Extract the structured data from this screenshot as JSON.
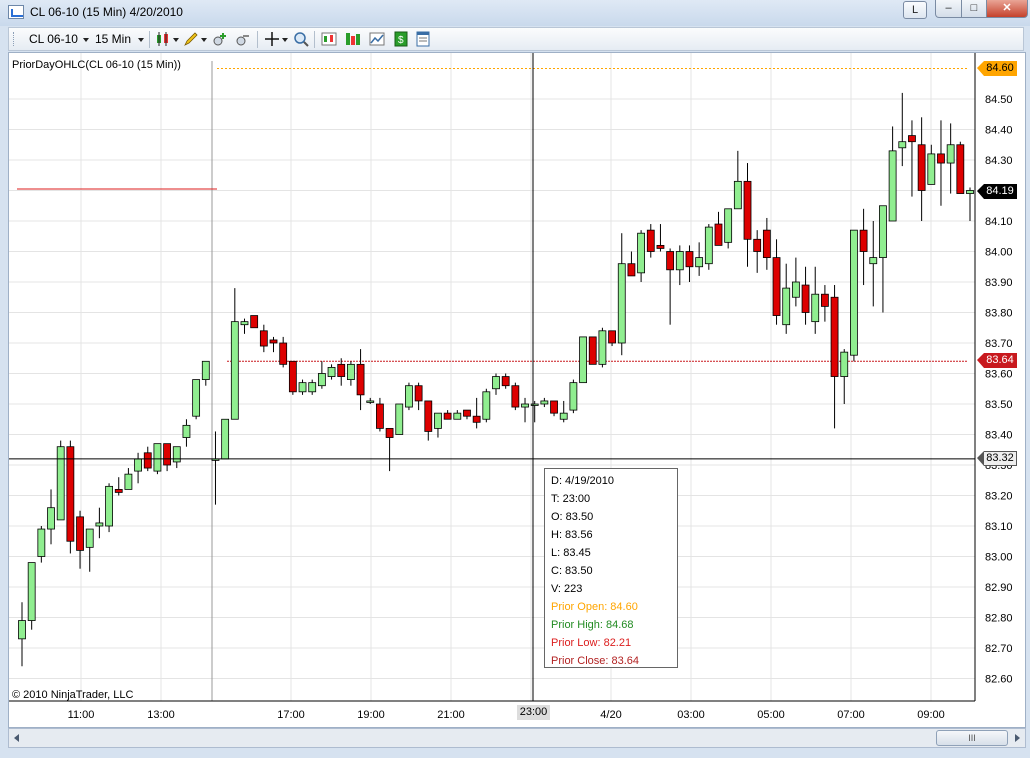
{
  "window": {
    "title": "CL 06-10 (15 Min)  4/20/2010",
    "btn_l": "L",
    "btn_min": "–",
    "btn_max": "□",
    "btn_close": "✕"
  },
  "toolbar": {
    "instrument": "CL 06-10",
    "interval": "15 Min",
    "icons": [
      "candlestick-style-icon",
      "pencil-draw-icon",
      "zoom-in-icon",
      "zoom-out-icon",
      "crosshair-icon",
      "magnifier-icon",
      "data-series-icon",
      "indicators-icon",
      "strategies-icon",
      "order-icon",
      "properties-icon"
    ]
  },
  "chart": {
    "indicator_label": "PriorDayOHLC(CL 06-10 (15 Min))",
    "copyright": "© 2010 NinjaTrader, LLC",
    "price_axis_labels": [
      "84.50",
      "84.40",
      "84.30",
      "84.20",
      "84.10",
      "84.00",
      "83.90",
      "83.80",
      "83.70",
      "83.60",
      "83.50",
      "83.40",
      "83.30",
      "83.20",
      "83.10",
      "83.00",
      "82.90",
      "82.80",
      "82.70",
      "82.60"
    ],
    "time_axis_labels": [
      "11:00",
      "13:00",
      "17:00",
      "19:00",
      "21:00",
      "23:00",
      "4/20",
      "03:00",
      "05:00",
      "07:00",
      "09:00"
    ],
    "price_tags": {
      "prior_open": "84.60",
      "last": "84.19",
      "prior_close": "83.64",
      "cursor": "83.32"
    },
    "colors": {
      "up": "#90ee90",
      "down": "#dd0000",
      "prior_open": "#ffa500",
      "prior_close": "#c8191e",
      "prior_low": "#dc1e1e"
    }
  },
  "chart_data": {
    "type": "candlestick",
    "title": "CL 06-10 (15 Min)",
    "y_range": [
      82.55,
      84.6
    ],
    "candles": [
      {
        "o": 82.73,
        "h": 82.85,
        "l": 82.64,
        "c": 82.79
      },
      {
        "o": 82.79,
        "h": 82.98,
        "l": 82.76,
        "c": 82.98
      },
      {
        "o": 83.0,
        "h": 83.1,
        "l": 82.98,
        "c": 83.09
      },
      {
        "o": 83.09,
        "h": 83.22,
        "l": 83.04,
        "c": 83.16
      },
      {
        "o": 83.12,
        "h": 83.38,
        "l": 83.12,
        "c": 83.36
      },
      {
        "o": 83.36,
        "h": 83.38,
        "l": 83.01,
        "c": 83.05
      },
      {
        "o": 83.13,
        "h": 83.15,
        "l": 82.96,
        "c": 83.02
      },
      {
        "o": 83.03,
        "h": 83.06,
        "l": 82.95,
        "c": 83.09
      },
      {
        "o": 83.1,
        "h": 83.16,
        "l": 83.06,
        "c": 83.11
      },
      {
        "o": 83.1,
        "h": 83.24,
        "l": 83.08,
        "c": 83.23
      },
      {
        "o": 83.22,
        "h": 83.26,
        "l": 83.2,
        "c": 83.21
      },
      {
        "o": 83.22,
        "h": 83.29,
        "l": 83.22,
        "c": 83.27
      },
      {
        "o": 83.28,
        "h": 83.34,
        "l": 83.24,
        "c": 83.32
      },
      {
        "o": 83.34,
        "h": 83.36,
        "l": 83.28,
        "c": 83.29
      },
      {
        "o": 83.28,
        "h": 83.37,
        "l": 83.27,
        "c": 83.37
      },
      {
        "o": 83.37,
        "h": 83.37,
        "l": 83.28,
        "c": 83.3
      },
      {
        "o": 83.31,
        "h": 83.36,
        "l": 83.29,
        "c": 83.36
      },
      {
        "o": 83.39,
        "h": 83.45,
        "l": 83.36,
        "c": 83.43
      },
      {
        "o": 83.46,
        "h": 83.58,
        "l": 83.45,
        "c": 83.58
      },
      {
        "o": 83.58,
        "h": 83.64,
        "l": 83.56,
        "c": 83.64
      },
      {
        "o": 83.32,
        "h": 83.41,
        "l": 83.17,
        "c": 83.32
      },
      {
        "o": 83.32,
        "h": 83.45,
        "l": 83.32,
        "c": 83.45
      },
      {
        "o": 83.45,
        "h": 83.88,
        "l": 83.45,
        "c": 83.77
      },
      {
        "o": 83.76,
        "h": 83.78,
        "l": 83.73,
        "c": 83.77
      },
      {
        "o": 83.79,
        "h": 83.79,
        "l": 83.75,
        "c": 83.75
      },
      {
        "o": 83.74,
        "h": 83.76,
        "l": 83.67,
        "c": 83.69
      },
      {
        "o": 83.71,
        "h": 83.72,
        "l": 83.67,
        "c": 83.7
      },
      {
        "o": 83.7,
        "h": 83.72,
        "l": 83.62,
        "c": 83.63
      },
      {
        "o": 83.64,
        "h": 83.64,
        "l": 83.53,
        "c": 83.54
      },
      {
        "o": 83.54,
        "h": 83.58,
        "l": 83.53,
        "c": 83.57
      },
      {
        "o": 83.54,
        "h": 83.58,
        "l": 83.53,
        "c": 83.57
      },
      {
        "o": 83.56,
        "h": 83.64,
        "l": 83.55,
        "c": 83.6
      },
      {
        "o": 83.59,
        "h": 83.63,
        "l": 83.58,
        "c": 83.62
      },
      {
        "o": 83.63,
        "h": 83.65,
        "l": 83.56,
        "c": 83.59
      },
      {
        "o": 83.58,
        "h": 83.64,
        "l": 83.56,
        "c": 83.63
      },
      {
        "o": 83.63,
        "h": 83.68,
        "l": 83.48,
        "c": 83.53
      },
      {
        "o": 83.51,
        "h": 83.52,
        "l": 83.5,
        "c": 83.51
      },
      {
        "o": 83.5,
        "h": 83.52,
        "l": 83.41,
        "c": 83.42
      },
      {
        "o": 83.42,
        "h": 83.42,
        "l": 83.28,
        "c": 83.39
      },
      {
        "o": 83.4,
        "h": 83.5,
        "l": 83.4,
        "c": 83.5
      },
      {
        "o": 83.49,
        "h": 83.57,
        "l": 83.48,
        "c": 83.56
      },
      {
        "o": 83.56,
        "h": 83.57,
        "l": 83.48,
        "c": 83.51
      },
      {
        "o": 83.51,
        "h": 83.51,
        "l": 83.38,
        "c": 83.41
      },
      {
        "o": 83.42,
        "h": 83.47,
        "l": 83.39,
        "c": 83.47
      },
      {
        "o": 83.47,
        "h": 83.48,
        "l": 83.45,
        "c": 83.45
      },
      {
        "o": 83.45,
        "h": 83.48,
        "l": 83.45,
        "c": 83.47
      },
      {
        "o": 83.48,
        "h": 83.48,
        "l": 83.45,
        "c": 83.46
      },
      {
        "o": 83.46,
        "h": 83.52,
        "l": 83.42,
        "c": 83.44
      },
      {
        "o": 83.45,
        "h": 83.55,
        "l": 83.44,
        "c": 83.54
      },
      {
        "o": 83.55,
        "h": 83.6,
        "l": 83.53,
        "c": 83.59
      },
      {
        "o": 83.59,
        "h": 83.6,
        "l": 83.55,
        "c": 83.56
      },
      {
        "o": 83.56,
        "h": 83.57,
        "l": 83.48,
        "c": 83.49
      },
      {
        "o": 83.49,
        "h": 83.52,
        "l": 83.44,
        "c": 83.5
      },
      {
        "o": 83.5,
        "h": 83.51,
        "l": 83.44,
        "c": 83.5
      },
      {
        "o": 83.5,
        "h": 83.52,
        "l": 83.49,
        "c": 83.51
      },
      {
        "o": 83.51,
        "h": 83.51,
        "l": 83.46,
        "c": 83.47
      },
      {
        "o": 83.45,
        "h": 83.51,
        "l": 83.44,
        "c": 83.47
      },
      {
        "o": 83.48,
        "h": 83.58,
        "l": 83.47,
        "c": 83.57
      },
      {
        "o": 83.57,
        "h": 83.72,
        "l": 83.57,
        "c": 83.72
      },
      {
        "o": 83.72,
        "h": 83.72,
        "l": 83.63,
        "c": 83.63
      },
      {
        "o": 83.63,
        "h": 83.75,
        "l": 83.62,
        "c": 83.74
      },
      {
        "o": 83.74,
        "h": 83.72,
        "l": 83.69,
        "c": 83.7
      },
      {
        "o": 83.7,
        "h": 84.06,
        "l": 83.66,
        "c": 83.96
      },
      {
        "o": 83.96,
        "h": 84.0,
        "l": 83.92,
        "c": 83.92
      },
      {
        "o": 83.93,
        "h": 84.07,
        "l": 83.9,
        "c": 84.06
      },
      {
        "o": 84.07,
        "h": 84.09,
        "l": 83.98,
        "c": 84.0
      },
      {
        "o": 84.02,
        "h": 84.09,
        "l": 84.0,
        "c": 84.01
      },
      {
        "o": 84.0,
        "h": 84.01,
        "l": 83.76,
        "c": 83.94
      },
      {
        "o": 83.94,
        "h": 84.02,
        "l": 83.89,
        "c": 84.0
      },
      {
        "o": 84.0,
        "h": 84.02,
        "l": 83.9,
        "c": 83.95
      },
      {
        "o": 83.95,
        "h": 84.03,
        "l": 83.92,
        "c": 83.98
      },
      {
        "o": 83.96,
        "h": 84.09,
        "l": 83.94,
        "c": 84.08
      },
      {
        "o": 84.09,
        "h": 84.13,
        "l": 84.02,
        "c": 84.02
      },
      {
        "o": 84.03,
        "h": 84.14,
        "l": 84.01,
        "c": 84.14
      },
      {
        "o": 84.14,
        "h": 84.33,
        "l": 84.14,
        "c": 84.23
      },
      {
        "o": 84.23,
        "h": 84.29,
        "l": 83.95,
        "c": 84.04
      },
      {
        "o": 84.04,
        "h": 84.07,
        "l": 83.93,
        "c": 84.0
      },
      {
        "o": 84.07,
        "h": 84.11,
        "l": 83.94,
        "c": 83.98
      },
      {
        "o": 83.98,
        "h": 84.04,
        "l": 83.76,
        "c": 83.79
      },
      {
        "o": 83.76,
        "h": 83.96,
        "l": 83.73,
        "c": 83.88
      },
      {
        "o": 83.85,
        "h": 83.98,
        "l": 83.82,
        "c": 83.9
      },
      {
        "o": 83.89,
        "h": 83.95,
        "l": 83.76,
        "c": 83.8
      },
      {
        "o": 83.77,
        "h": 83.95,
        "l": 83.73,
        "c": 83.86
      },
      {
        "o": 83.86,
        "h": 83.89,
        "l": 83.77,
        "c": 83.82
      },
      {
        "o": 83.85,
        "h": 83.89,
        "l": 83.42,
        "c": 83.59
      },
      {
        "o": 83.59,
        "h": 83.68,
        "l": 83.5,
        "c": 83.67
      },
      {
        "o": 83.66,
        "h": 83.88,
        "l": 83.64,
        "c": 84.07
      },
      {
        "o": 84.07,
        "h": 84.14,
        "l": 83.89,
        "c": 84.0
      },
      {
        "o": 83.96,
        "h": 84.1,
        "l": 83.82,
        "c": 83.98
      },
      {
        "o": 83.98,
        "h": 84.15,
        "l": 83.8,
        "c": 84.15
      },
      {
        "o": 84.1,
        "h": 84.41,
        "l": 84.1,
        "c": 84.33
      },
      {
        "o": 84.34,
        "h": 84.52,
        "l": 84.28,
        "c": 84.36
      },
      {
        "o": 84.38,
        "h": 84.43,
        "l": 84.18,
        "c": 84.36
      },
      {
        "o": 84.35,
        "h": 84.44,
        "l": 84.1,
        "c": 84.2
      },
      {
        "o": 84.22,
        "h": 84.35,
        "l": 84.22,
        "c": 84.32
      },
      {
        "o": 84.32,
        "h": 84.43,
        "l": 84.15,
        "c": 84.29
      },
      {
        "o": 84.29,
        "h": 84.42,
        "l": 84.19,
        "c": 84.35
      },
      {
        "o": 84.35,
        "h": 84.36,
        "l": 84.19,
        "c": 84.19
      },
      {
        "o": 84.19,
        "h": 84.21,
        "l": 84.1,
        "c": 84.2
      }
    ],
    "prior_day_levels": {
      "open": 84.6,
      "high": 84.68,
      "low": 82.21,
      "close": 83.64
    },
    "crosshair": {
      "time": "23:00",
      "price": 83.32
    }
  },
  "data_box": {
    "date": "D: 4/19/2010",
    "time": "T: 23:00",
    "open": "O: 83.50",
    "high": "H: 83.56",
    "low": "L: 83.45",
    "close": "C: 83.50",
    "volume": "V: 223",
    "prior_open": "Prior Open: 84.60",
    "prior_high": "Prior High: 84.68",
    "prior_low": "Prior Low: 82.21",
    "prior_close": "Prior Close: 83.64"
  },
  "hscroll": {
    "thumb_grip": "III"
  }
}
